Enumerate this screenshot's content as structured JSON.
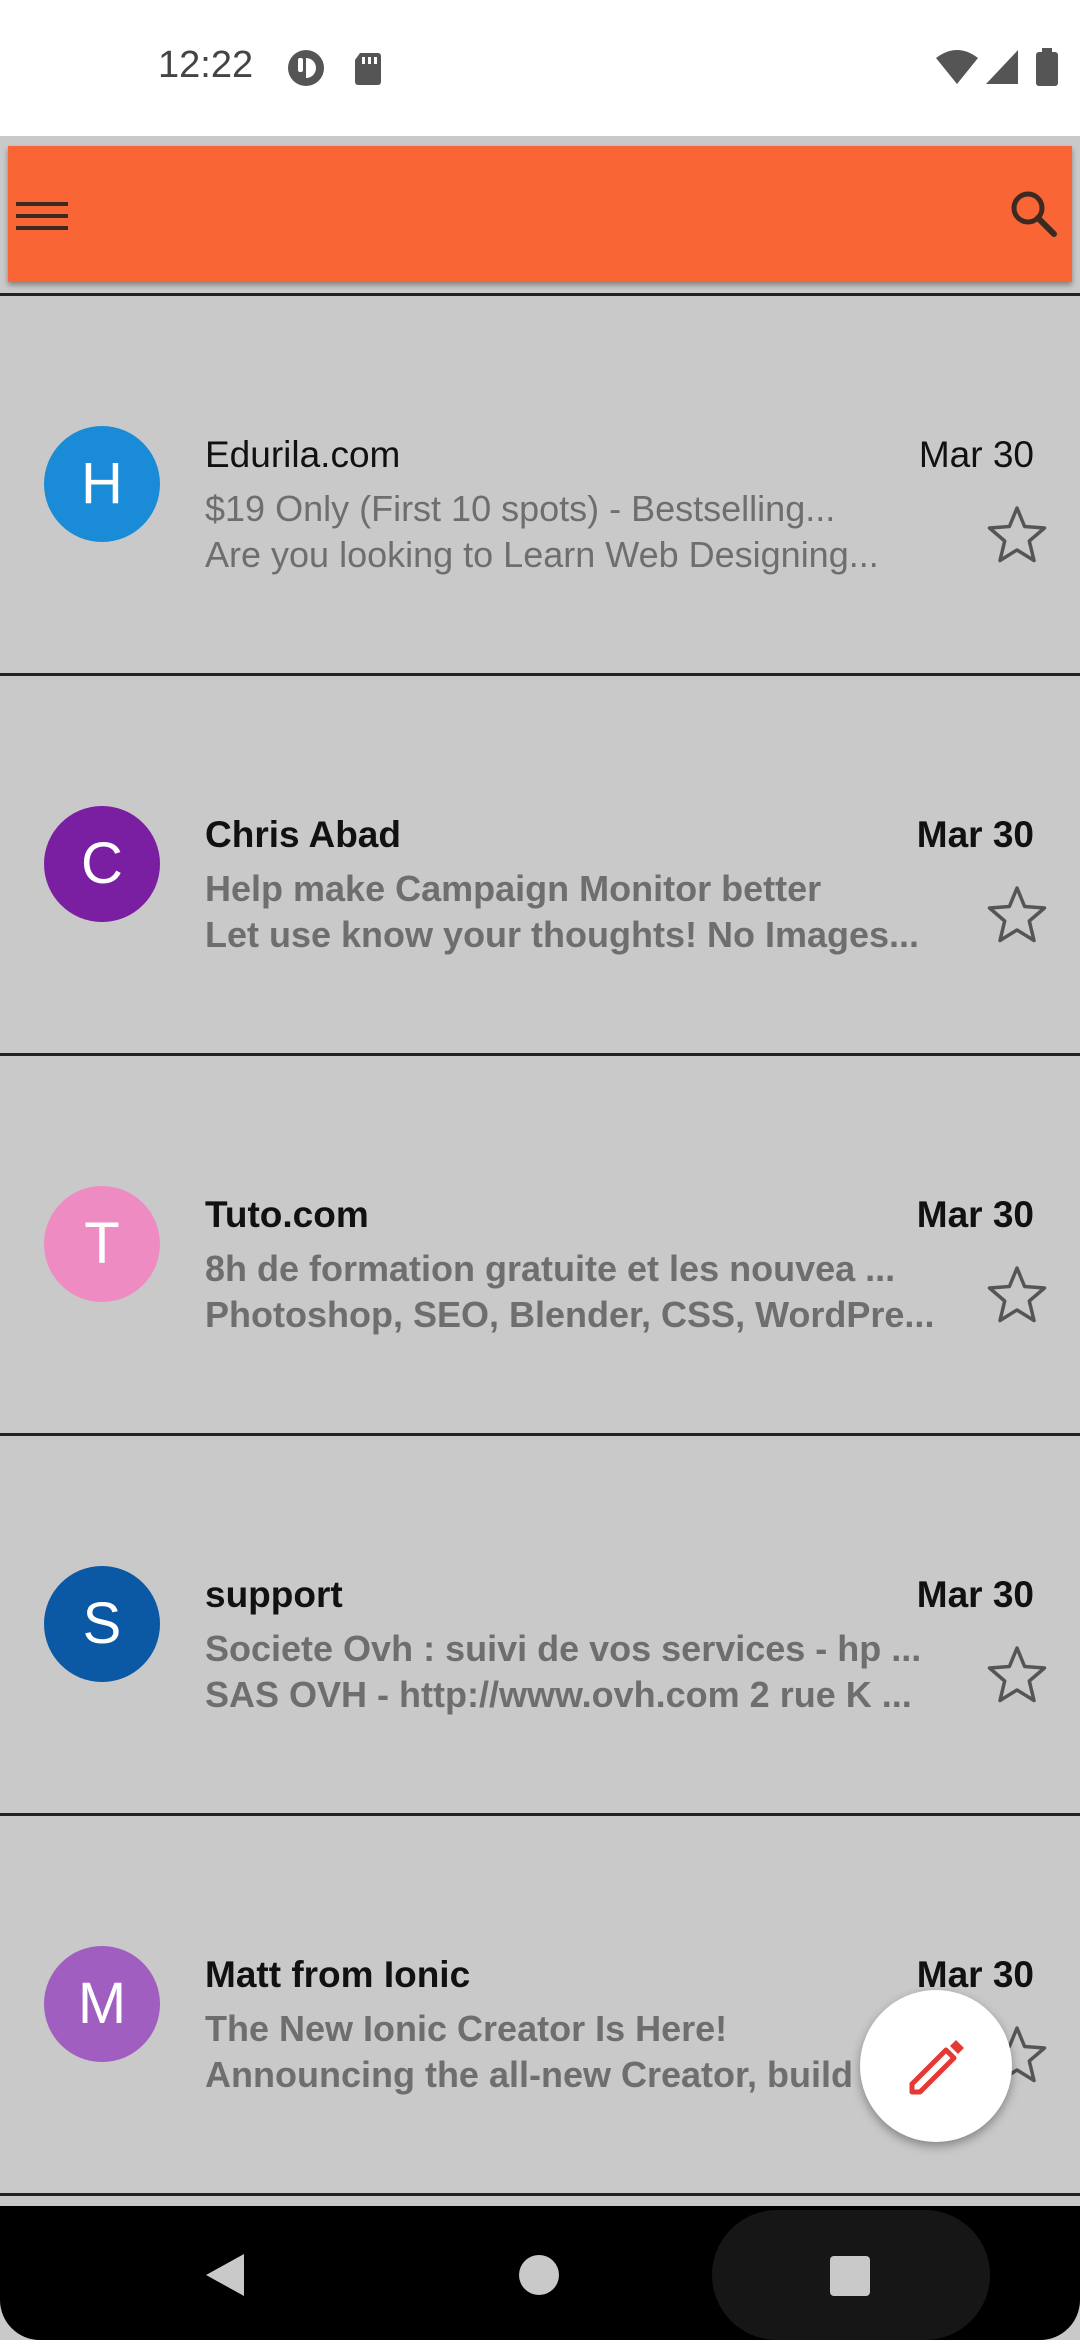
{
  "status_bar": {
    "time": "12:22",
    "icons": [
      "media-icon",
      "sd-card-icon",
      "wifi-icon",
      "signal-icon",
      "battery-icon"
    ]
  },
  "toolbar": {
    "color": "#fa6536",
    "menu_icon": "hamburger-menu-icon",
    "search_icon": "search-icon"
  },
  "emails": [
    {
      "initial": "H",
      "avatar_color": "#1a8bd6",
      "sender": "Edurila.com",
      "date": "Mar 30",
      "subject": "$19 Only (First 10 spots) - Bestselling...",
      "preview": "Are you looking to Learn Web Designing...",
      "unread": false
    },
    {
      "initial": "C",
      "avatar_color": "#7a1fa2",
      "sender": "Chris Abad",
      "date": "Mar 30",
      "subject": "Help make Campaign Monitor better",
      "preview": "Let use know your thoughts! No Images...",
      "unread": true
    },
    {
      "initial": "T",
      "avatar_color": "#ee8bc3",
      "sender": "Tuto.com",
      "date": "Mar 30",
      "subject": "8h de formation gratuite et les nouvea ...",
      "preview": "Photoshop, SEO, Blender, CSS, WordPre...",
      "unread": true
    },
    {
      "initial": "S",
      "avatar_color": "#0b58a5",
      "sender": "support",
      "date": "Mar 30",
      "subject": "Societe Ovh : suivi de vos services - hp ...",
      "preview": "SAS OVH - http://www.ovh.com 2 rue K ...",
      "unread": true
    },
    {
      "initial": "M",
      "avatar_color": "#9f5ec0",
      "sender": "Matt from Ionic",
      "date": "Mar 30",
      "subject": "The New Ionic Creator Is Here!",
      "preview": "Announcing the all-new Creator, build",
      "unread": true
    }
  ],
  "fab": {
    "icon": "pencil-icon",
    "icon_color": "#e53935"
  },
  "nav_bar": {
    "icons": [
      "back-icon",
      "home-icon",
      "recents-icon"
    ]
  }
}
